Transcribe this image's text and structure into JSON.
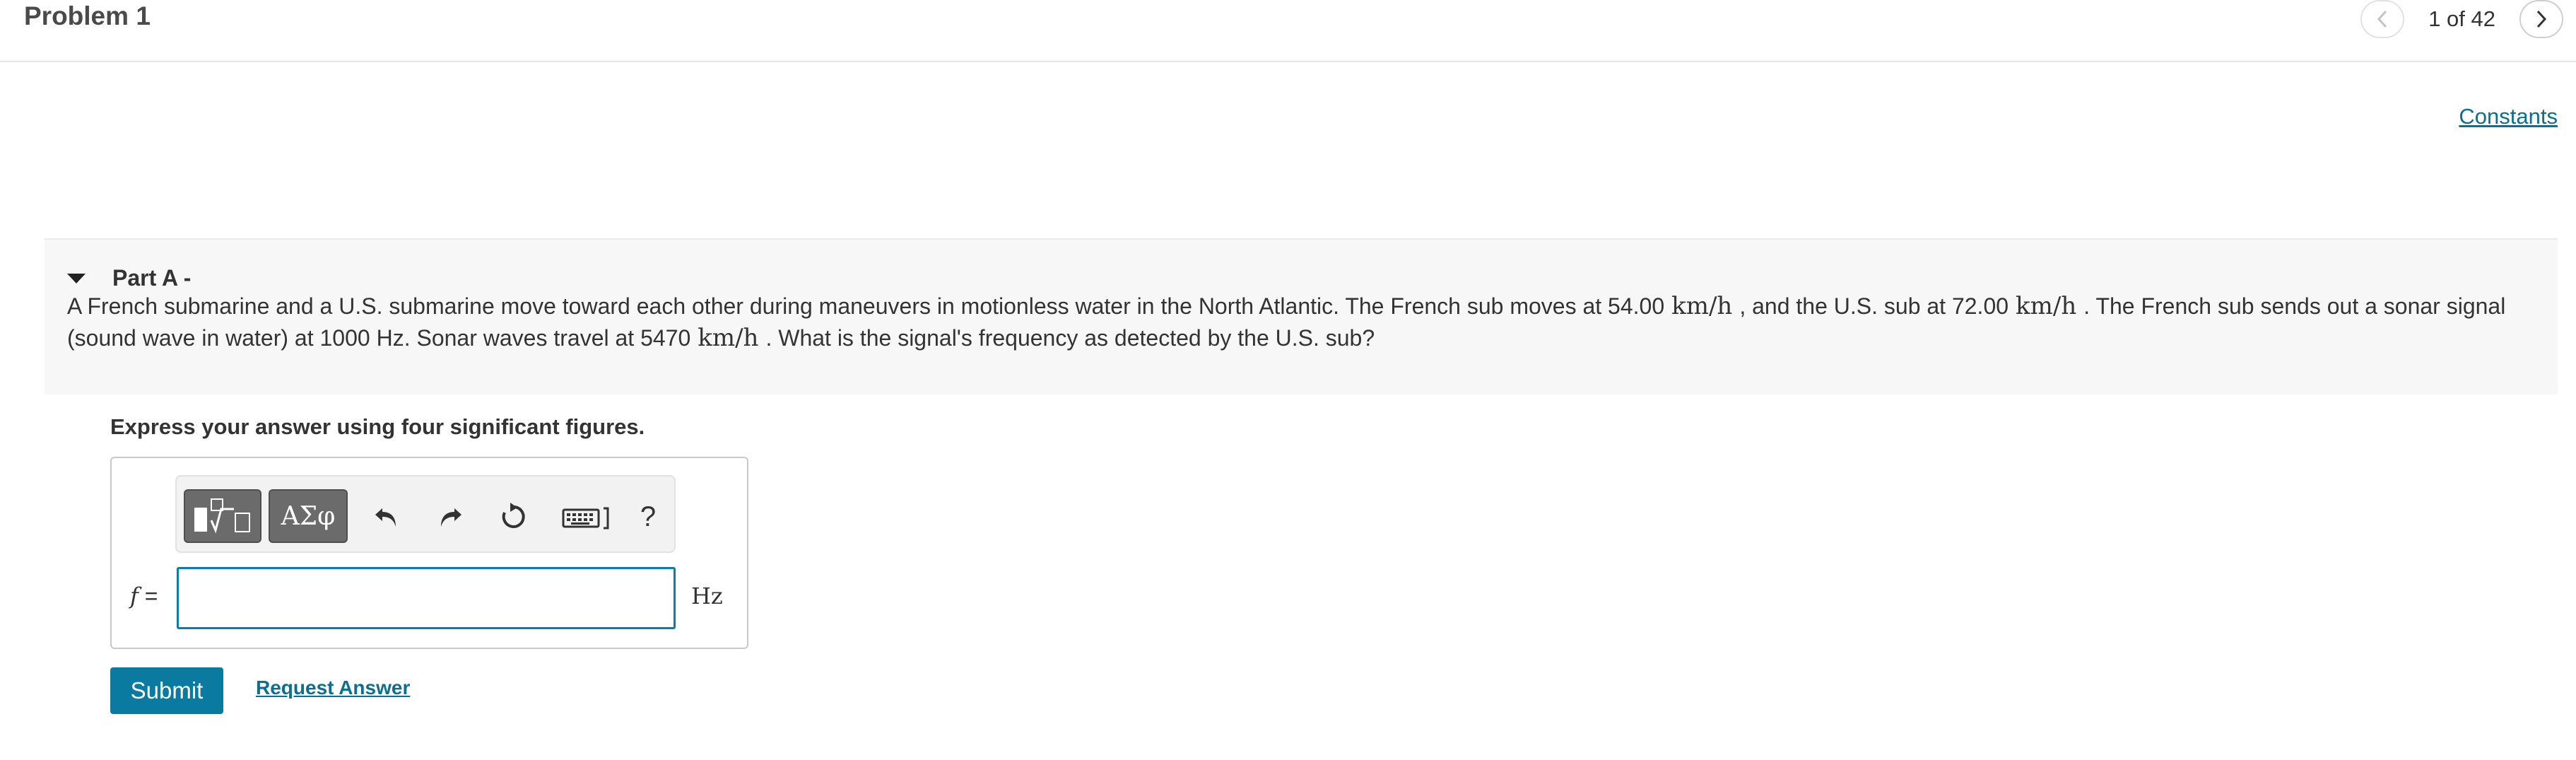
{
  "header": {
    "title": "Problem 1",
    "page_indicator": "1 of 42"
  },
  "links": {
    "constants": "Constants",
    "request_answer": "Request Answer"
  },
  "part": {
    "title": "Part A -",
    "question_parts": [
      "A French submarine and a U.S. submarine move toward each other during maneuvers in motionless water in the North Atlantic. The French sub moves at 54.00",
      "km/h",
      ", and the U.S. sub at 72.00",
      "km/h",
      ". The French sub sends out a sonar signal (sound wave in water) at 1000 Hz. Sonar waves travel at 5470",
      "km/h",
      ". What is the signal's frequency as detected by the U.S. sub?"
    ]
  },
  "answer": {
    "instruction": "Express your answer using four significant figures.",
    "variable": "f",
    "equals": "=",
    "input_value": "",
    "unit": "Hz",
    "toolbar": {
      "greek_label": "ΑΣφ",
      "help_label": "?",
      "icons": [
        "templates-icon",
        "greek-symbols-icon",
        "undo-icon",
        "redo-icon",
        "reset-icon",
        "keyboard-icon",
        "help-icon"
      ]
    },
    "submit_label": "Submit"
  },
  "colors": {
    "accent": "#0a7aa0",
    "link": "#0a6f90",
    "panel_bg": "#f7f7f7"
  }
}
